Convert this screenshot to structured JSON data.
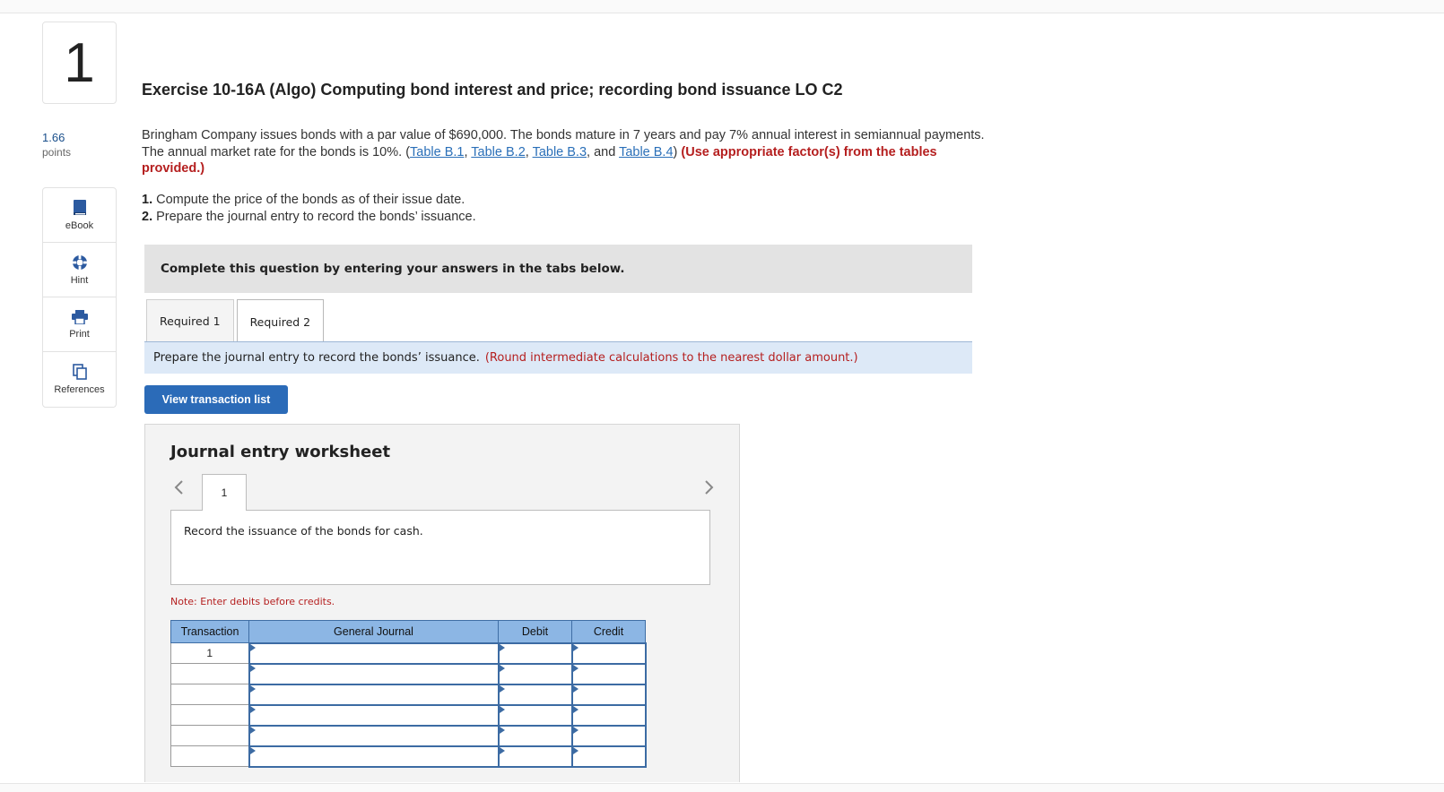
{
  "question": {
    "number": "1",
    "points_value": "1.66",
    "points_label": "points",
    "title": "Exercise 10-16A (Algo) Computing bond interest and price; recording bond issuance LO C2"
  },
  "tools": [
    {
      "label": "eBook",
      "icon": "book-icon"
    },
    {
      "label": "Hint",
      "icon": "lifebuoy-icon"
    },
    {
      "label": "Print",
      "icon": "printer-icon"
    },
    {
      "label": "References",
      "icon": "documents-icon"
    }
  ],
  "intro": {
    "text_before": "Bringham Company issues bonds with a par value of $690,000. The bonds mature in 7 years and pay 7% annual interest in semiannual payments. The annual market rate for the bonds is 10%. (",
    "link1": "Table B.1",
    "sep1": ", ",
    "link2": "Table B.2",
    "sep2": ", ",
    "link3": "Table B.3",
    "sep3": ", and ",
    "link4": "Table B.4",
    "text_after": ") ",
    "emphasis": "(Use appropriate factor(s) from the tables provided.)"
  },
  "steps": [
    {
      "num": "1.",
      "text": " Compute the price of the bonds as of their issue date."
    },
    {
      "num": "2.",
      "text": " Prepare the journal entry to record the bonds’ issuance."
    }
  ],
  "instruction": "Complete this question by entering your answers in the tabs below.",
  "tabs": [
    {
      "label": "Required 1",
      "active": false
    },
    {
      "label": "Required 2",
      "active": true
    }
  ],
  "prepare": {
    "text": "Prepare the journal entry to record the bonds’ issuance.",
    "note": "(Round intermediate calculations to the nearest dollar amount.)"
  },
  "view_button": "View transaction list",
  "worksheet": {
    "title": "Journal entry worksheet",
    "page": "1",
    "description": "Record the issuance of the bonds for cash.",
    "note": "Note: Enter debits before credits.",
    "columns": [
      "Transaction",
      "General Journal",
      "Debit",
      "Credit"
    ],
    "rows": [
      {
        "transaction": "1",
        "account": "",
        "debit": "",
        "credit": ""
      },
      {
        "transaction": "",
        "account": "",
        "debit": "",
        "credit": ""
      },
      {
        "transaction": "",
        "account": "",
        "debit": "",
        "credit": ""
      },
      {
        "transaction": "",
        "account": "",
        "debit": "",
        "credit": ""
      },
      {
        "transaction": "",
        "account": "",
        "debit": "",
        "credit": ""
      },
      {
        "transaction": "",
        "account": "",
        "debit": "",
        "credit": ""
      }
    ]
  },
  "colors": {
    "link": "#2a6fb8",
    "alert_red": "#b51f1f",
    "button_blue": "#2b6bb8",
    "table_header": "#8cb6e4",
    "prepare_bg": "#dde9f7"
  }
}
